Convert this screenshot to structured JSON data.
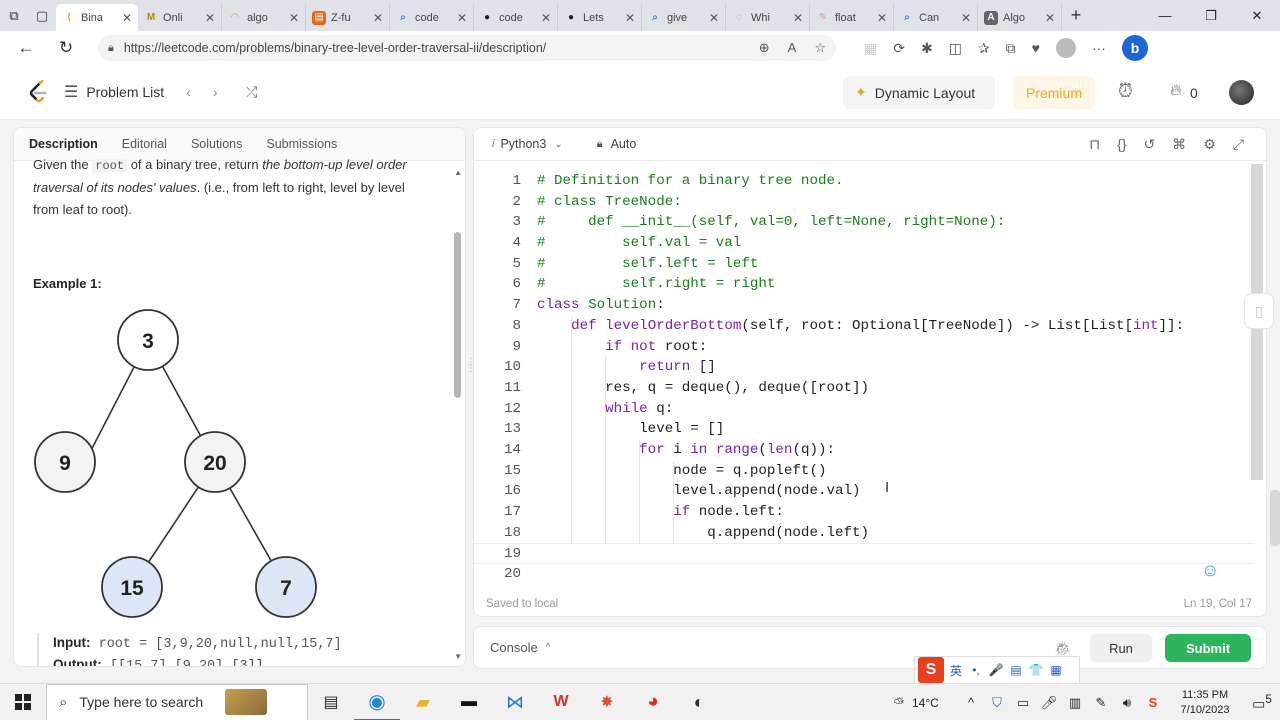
{
  "browser": {
    "tabs": [
      {
        "label": "Bina",
        "icon": "leetcode",
        "active": true
      },
      {
        "label": "Onli",
        "icon": "sheets"
      },
      {
        "label": "algo",
        "icon": "algo"
      },
      {
        "label": "Z-fu",
        "icon": "doc-orange"
      },
      {
        "label": "code",
        "icon": "search"
      },
      {
        "label": "code",
        "icon": "github"
      },
      {
        "label": "Lets",
        "icon": "github"
      },
      {
        "label": "give",
        "icon": "search"
      },
      {
        "label": "Whi",
        "icon": "web"
      },
      {
        "label": "float",
        "icon": "doc"
      },
      {
        "label": "Can",
        "icon": "search"
      },
      {
        "label": "Algo",
        "icon": "doc-gray"
      }
    ],
    "url": "https://leetcode.com/problems/binary-tree-level-order-traversal-ii/description/"
  },
  "header": {
    "problem_list": "Problem List",
    "dynamic_layout": "Dynamic Layout",
    "premium": "Premium",
    "streak_count": "0"
  },
  "left_panel": {
    "tabs": [
      "Description",
      "Editorial",
      "Solutions",
      "Submissions"
    ],
    "desc_prefix": "Given the ",
    "desc_code": "root",
    "desc_mid": " of a binary tree, return ",
    "desc_italic": "the bottom-up level order traversal of its nodes' values",
    "desc_suffix": ". (i.e., from left to right, level by level from leaf to root).",
    "example_title": "Example 1:",
    "tree_nodes": [
      "3",
      "9",
      "20",
      "15",
      "7"
    ],
    "input_label": "Input:",
    "input_value": "root = [3,9,20,null,null,15,7]",
    "output_label": "Output:",
    "output_value": "[[15,7],[9,20],[3]]"
  },
  "editor": {
    "language": "Python3",
    "mode": "Auto",
    "saved_status": "Saved to local",
    "cursor_pos": "Ln 19, Col 17"
  },
  "console": {
    "label": "Console",
    "run": "Run",
    "submit": "Submit"
  },
  "ime": {
    "items": [
      "英",
      "•,",
      "🎤",
      "▤",
      "👕",
      "▦"
    ]
  },
  "taskbar": {
    "search_placeholder": "Type here to search",
    "weather": "14°C",
    "time": "11:35 PM",
    "date": "7/10/2023",
    "notif_count": "5"
  }
}
